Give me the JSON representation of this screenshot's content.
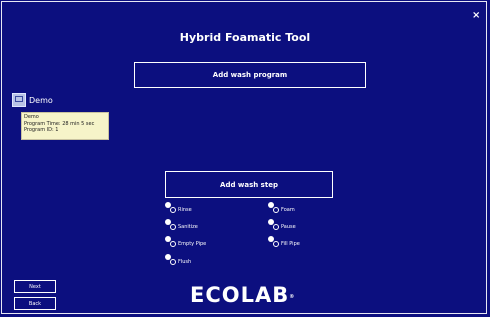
{
  "window": {
    "title": "Hybrid Foamatic Tool",
    "close_glyph": "×"
  },
  "actions": {
    "add_program_label": "Add wash program",
    "add_step_label": "Add wash step"
  },
  "program": {
    "icon": "program-icon",
    "name": "Demo",
    "tooltip": [
      "Demo",
      "Program Time: 28 min 5 sec",
      "Program ID: 1"
    ]
  },
  "steps": [
    {
      "label": "Rinse",
      "icon": "gears-icon"
    },
    {
      "label": "Foam",
      "icon": "gears-icon"
    },
    {
      "label": "Sanitize",
      "icon": "gears-icon"
    },
    {
      "label": "Pause",
      "icon": "gears-icon"
    },
    {
      "label": "Empty Pipe",
      "icon": "gears-icon"
    },
    {
      "label": "Fill Pipe",
      "icon": "gears-icon"
    },
    {
      "label": "Flush",
      "icon": "gears-icon"
    }
  ],
  "nav": {
    "next_label": "Next",
    "back_label": "Back"
  },
  "brand": {
    "logo_text": "ECOLAB",
    "registered": "®"
  },
  "colors": {
    "background": "#0c0f7f",
    "text": "#ffffff",
    "tooltip_bg": "#f6f4c9"
  }
}
